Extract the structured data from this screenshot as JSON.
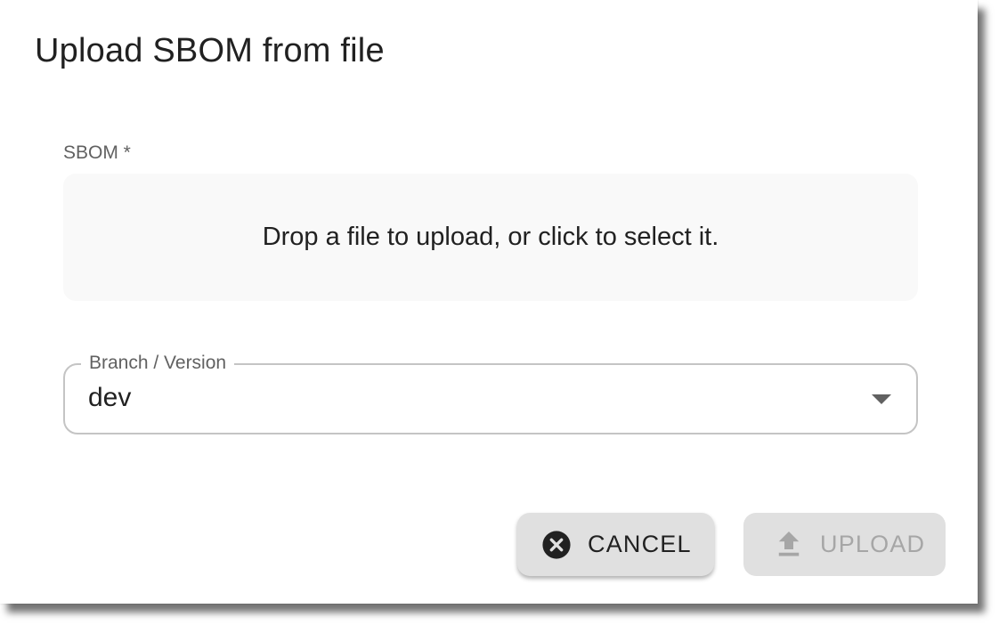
{
  "dialog": {
    "title": "Upload SBOM from file"
  },
  "sbom": {
    "label": "SBOM *",
    "dropzone_text": "Drop a file to upload, or click to select it."
  },
  "branch": {
    "label": "Branch / Version",
    "value": "dev"
  },
  "actions": {
    "cancel_label": "CANCEL",
    "cancel_icon": "cancel-circle-icon",
    "upload_label": "UPLOAD",
    "upload_icon": "upload-arrow-icon",
    "upload_enabled": false
  },
  "colors": {
    "text_primary": "#212121",
    "text_secondary": "#616161",
    "button_bg": "#e0e0e0",
    "disabled_text": "#a6a6a6",
    "dropzone_bg": "#f9f9f9"
  }
}
